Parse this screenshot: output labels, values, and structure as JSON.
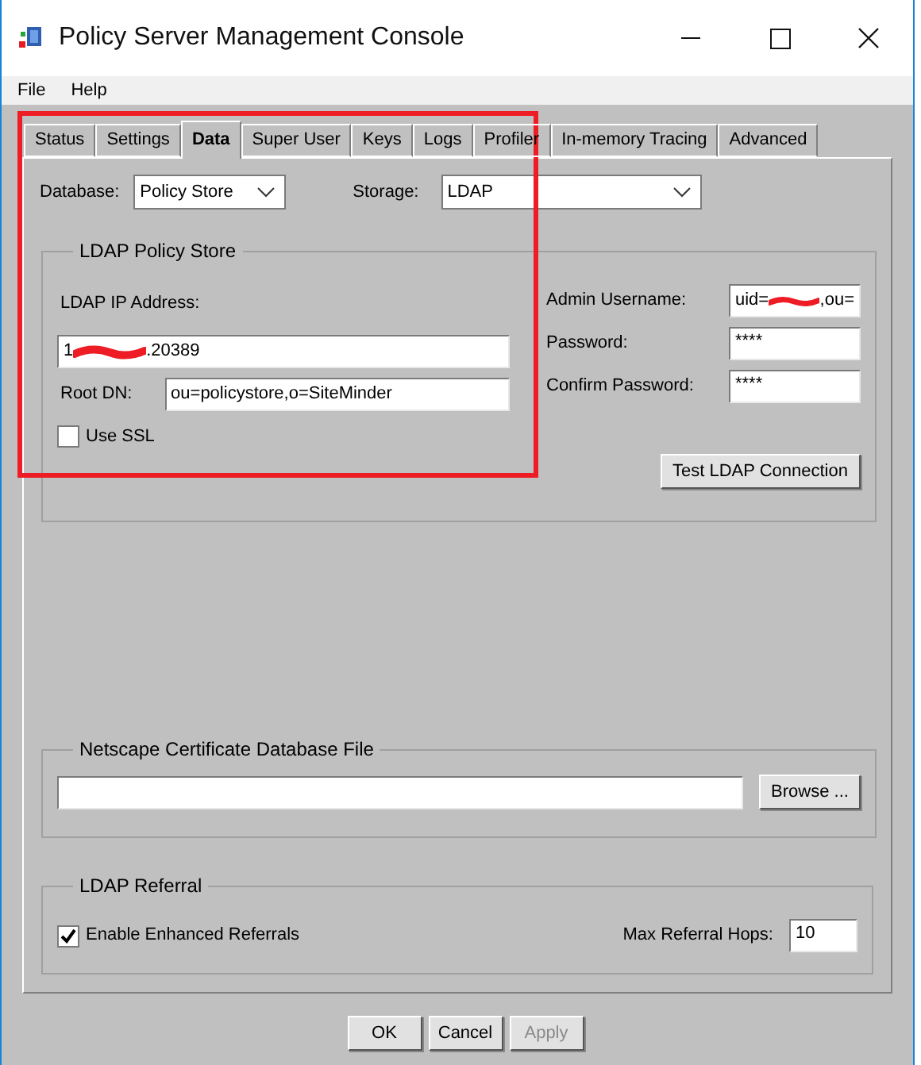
{
  "window": {
    "title": "Policy Server Management Console"
  },
  "menu": [
    {
      "label": "File"
    },
    {
      "label": "Help"
    }
  ],
  "tabs": [
    {
      "label": "Status",
      "selected": false
    },
    {
      "label": "Settings",
      "selected": false
    },
    {
      "label": "Data",
      "selected": true
    },
    {
      "label": "Super User",
      "selected": false
    },
    {
      "label": "Keys",
      "selected": false
    },
    {
      "label": "Logs",
      "selected": false
    },
    {
      "label": "Profiler",
      "selected": false
    },
    {
      "label": "In-memory Tracing",
      "selected": false
    },
    {
      "label": "Advanced",
      "selected": false
    }
  ],
  "database": {
    "label": "Database:",
    "value": "Policy Store"
  },
  "storage": {
    "label": "Storage:",
    "value": "LDAP"
  },
  "ldap_policy_store": {
    "title": "LDAP Policy Store",
    "ip_address": {
      "label": "LDAP IP Address:",
      "value_start": "1",
      "value_end": ".20389",
      "redacted": true
    },
    "root_dn": {
      "label": "Root DN:",
      "value": "ou=policystore,o=SiteMinder"
    },
    "use_ssl": {
      "label": "Use SSL",
      "checked": false
    },
    "admin_username": {
      "label": "Admin Username:",
      "value_start": "uid=",
      "value_end": ",ou=",
      "redacted": true
    },
    "password": {
      "label": "Password:",
      "value": "****"
    },
    "confirm_password": {
      "label": "Confirm Password:",
      "value": "****"
    },
    "test_button": "Test LDAP Connection"
  },
  "certificate_db": {
    "title": "Netscape Certificate Database File",
    "browse_button": "Browse ..."
  },
  "ldap_referral": {
    "title": "LDAP Referral",
    "enhanced": {
      "label": "Enable Enhanced Referrals",
      "checked": true
    },
    "max_hops": {
      "label": "Max Referral Hops:",
      "value": "10"
    }
  },
  "buttons": [
    {
      "label": "OK",
      "disabled": false
    },
    {
      "label": "Cancel",
      "disabled": false
    },
    {
      "label": "Apply",
      "disabled": true
    }
  ]
}
